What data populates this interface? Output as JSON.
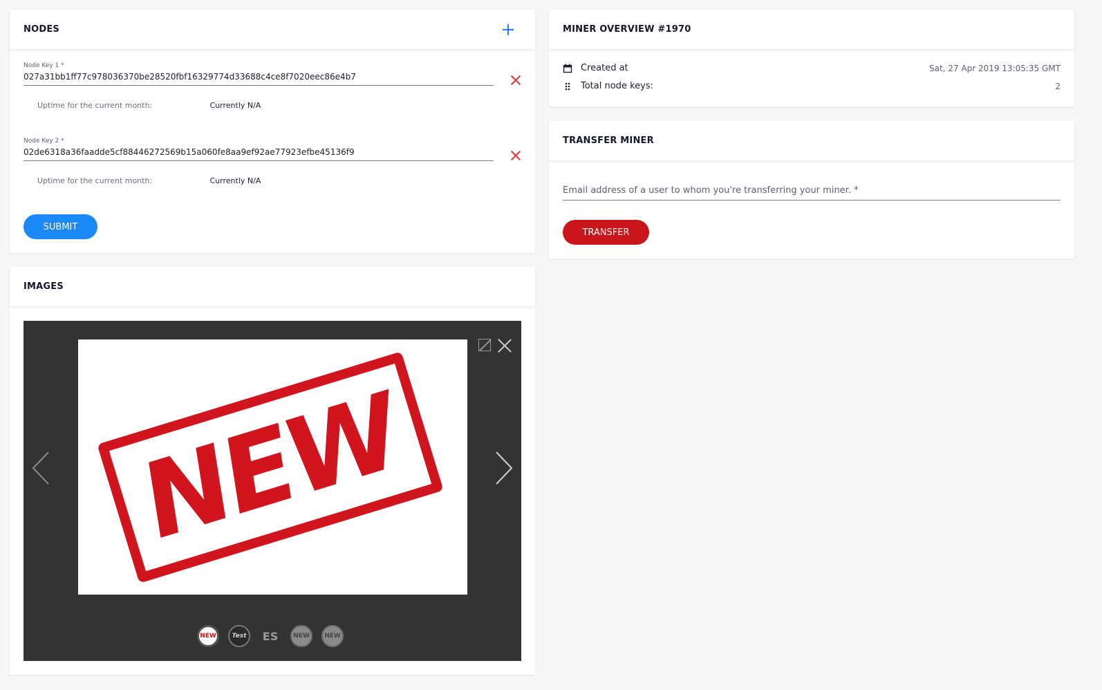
{
  "nodes": {
    "title": "NODES",
    "items": [
      {
        "label": "Node Key 1 *",
        "value": "027a31bb1ff77c978036370be28520fbf16329774d33688c4ce8f7020eec86e4b7",
        "uptime_label": "Uptime for the current month:",
        "uptime_value": "Currently N/A"
      },
      {
        "label": "Node Key 2 *",
        "value": "02de6318a36faadde5cf88446272569b15a060fe8aa9ef92ae77923efbe45136f9",
        "uptime_label": "Uptime for the current month:",
        "uptime_value": "Currently N/A"
      }
    ],
    "submit_label": "SUBMIT",
    "colors": {
      "primary": "#1a88f5",
      "remove": "#e63535"
    }
  },
  "images": {
    "title": "IMAGES",
    "main_image_text": "NEW",
    "thumbnails": [
      "NEW",
      "Test",
      "ES",
      "NEW",
      "NEW"
    ]
  },
  "overview": {
    "title": "MINER OVERVIEW #1970",
    "created_label": "Created at",
    "created_value": "Sat, 27 Apr 2019 13:05:35 GMT",
    "keys_label": "Total node keys:",
    "keys_value": "2"
  },
  "transfer": {
    "title": "TRANSFER MINER",
    "email_placeholder": "Email address of a user to whom you're transferring your miner. *",
    "button_label": "TRANSFER",
    "color": "#c8141b"
  }
}
